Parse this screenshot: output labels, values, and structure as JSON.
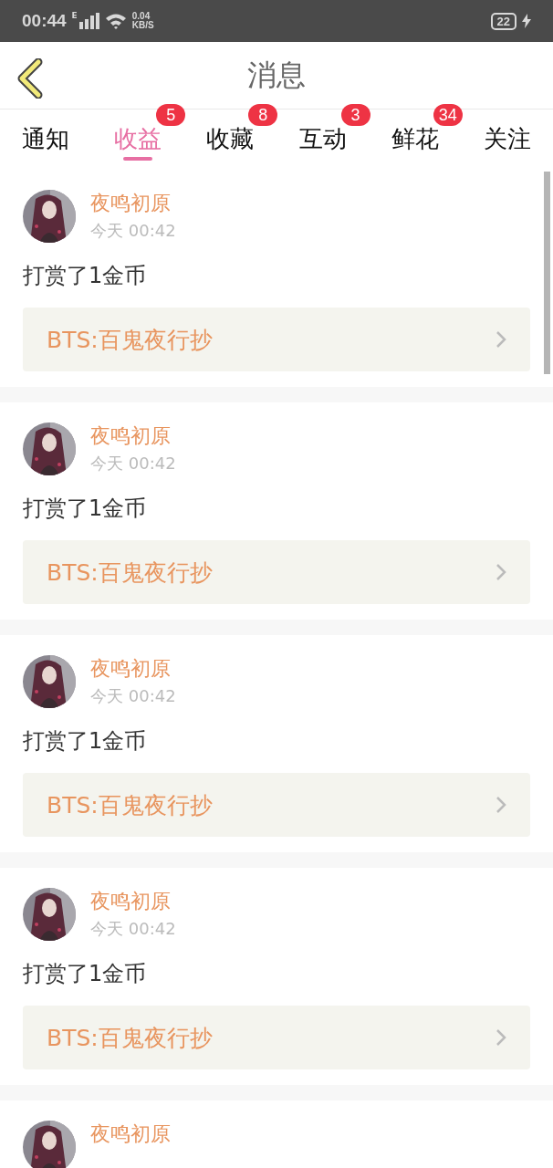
{
  "status_bar": {
    "time": "00:44",
    "network": "E",
    "speed": "0.04",
    "speed_unit": "KB/S",
    "battery": "22"
  },
  "header": {
    "title": "消息"
  },
  "tabs": [
    {
      "label": "通知",
      "selected": false
    },
    {
      "label": "收益",
      "selected": true,
      "badge": "5"
    },
    {
      "label": "收藏",
      "selected": false,
      "badge": "8"
    },
    {
      "label": "互动",
      "selected": false,
      "badge": "3"
    },
    {
      "label": "鲜花",
      "selected": false,
      "badge": "34"
    },
    {
      "label": "关注",
      "selected": false
    }
  ],
  "messages": [
    {
      "kind": "full",
      "user": "夜鸣初原",
      "time": "今天 00:42",
      "text": "打赏了1金币",
      "link": "BTS:百鬼夜行抄"
    },
    {
      "kind": "full",
      "user": "夜鸣初原",
      "time": "今天 00:42",
      "text": "打赏了1金币",
      "link": "BTS:百鬼夜行抄"
    },
    {
      "kind": "full",
      "user": "夜鸣初原",
      "time": "今天 00:42",
      "text": "打赏了1金币",
      "link": "BTS:百鬼夜行抄"
    },
    {
      "kind": "full",
      "user": "夜鸣初原",
      "time": "今天 00:42",
      "text": "打赏了1金币",
      "link": "BTS:百鬼夜行抄"
    },
    {
      "kind": "partial",
      "user": "夜鸣初原"
    }
  ]
}
